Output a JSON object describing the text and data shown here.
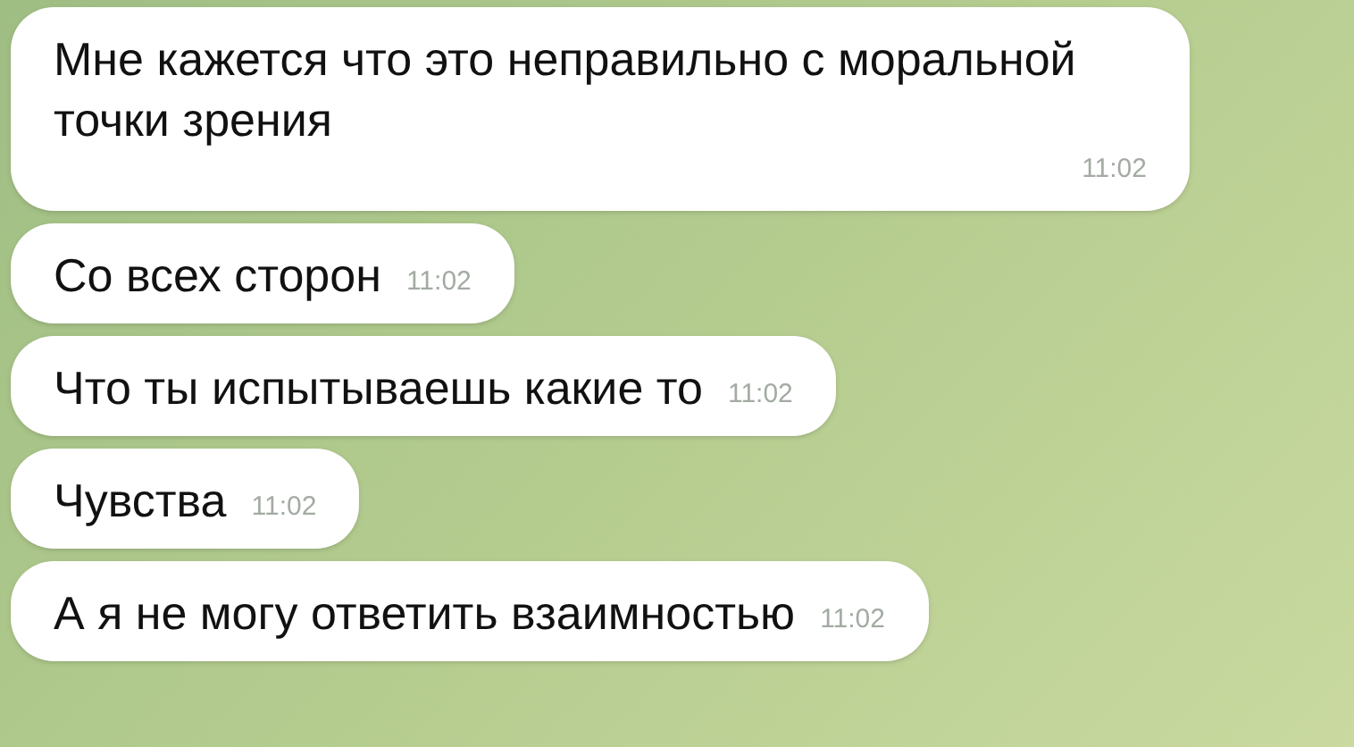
{
  "messages": [
    {
      "text": "Мне кажется что это неправильно с моральной точки зрения",
      "time": "11:02"
    },
    {
      "text": "Со всех сторон",
      "time": "11:02"
    },
    {
      "text": "Что ты испытываешь какие то",
      "time": "11:02"
    },
    {
      "text": "Чувства",
      "time": "11:02"
    },
    {
      "text": "А я не могу ответить взаимностью",
      "time": "11:02"
    }
  ]
}
